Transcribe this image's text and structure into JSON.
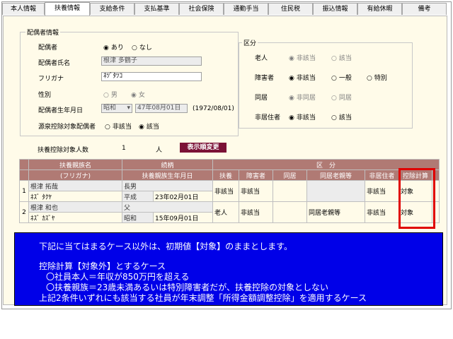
{
  "tabs": [
    "本人情報",
    "扶養情報",
    "支給条件",
    "支払基準",
    "社会保険",
    "通勤手当",
    "住民税",
    "振込情報",
    "有給休暇",
    "備考"
  ],
  "spouse": {
    "group_title": "配偶者情報",
    "has_spouse_label": "配偶者",
    "has_spouse_yes": "あり",
    "has_spouse_no": "なし",
    "name_label": "配偶者氏名",
    "name_value": "根津 多鶴子",
    "kana_label": "フリガナ",
    "kana_value": "ﾈﾂﾞﾀﾂｺ",
    "gender_label": "性別",
    "gender_male": "男",
    "gender_female": "女",
    "birth_label": "配偶者生年月日",
    "era_value": "昭和",
    "birth_value": "47年08月01日",
    "birth_western": "(1972/08/01)",
    "withholding_label": "源泉控除対象配偶者",
    "withholding_no": "非該当",
    "withholding_yes": "該当"
  },
  "classification": {
    "group_title": "区分",
    "elderly_label": "老人",
    "disabled_label": "障害者",
    "cohabit_label": "同居",
    "nonresident_label": "非居住者",
    "opt_na": "非該当",
    "opt_applicable": "該当",
    "opt_general": "一般",
    "opt_special": "特別",
    "opt_not_cohabit": "非同居",
    "opt_cohabit": "同居"
  },
  "dependents_count_label": "扶養控除対象人数",
  "dependents_count": "1",
  "dependents_count_unit": "人",
  "order_change_button": "表示順変更",
  "grid": {
    "header1": {
      "relation": "扶養親族名",
      "rel": "続柄",
      "category": "区　分"
    },
    "header2": {
      "kana": "(フリガナ)",
      "birth": "扶養親族生年月日",
      "dependent": "扶養",
      "disabled": "障害者",
      "cohabit": "同居",
      "elder_cohabit": "同居老親等",
      "nonresident": "非居住者",
      "deduction": "控除計算"
    },
    "rows": [
      {
        "no": "1",
        "name": "根津 拓哉",
        "kana": "ﾈｽﾞ ﾀｸﾔ",
        "relation": "長男",
        "era": "平成",
        "birth": "23年02月01日",
        "dependent": "非該当",
        "disabled": "非該当",
        "cohabit": "",
        "elder": "",
        "nonresident": "非該当",
        "deduction": "対象"
      },
      {
        "no": "2",
        "name": "根津 和也",
        "kana": "ﾈｽﾞ ｶｽﾞﾔ",
        "relation": "父",
        "era": "昭和",
        "birth": "15年09月01日",
        "dependent": "老人",
        "disabled": "非該当",
        "cohabit": "",
        "elder": "同居老親等",
        "nonresident": "非該当",
        "deduction": "対象"
      }
    ]
  },
  "overlay": {
    "line1": "下記に当てはまるケース以外は、初期値【対象】のままとします。",
    "line2": "控除計算【対象外】とするケース",
    "line3": "〇社員本人＝年収が850万円を超える",
    "line4": "〇扶養親族＝23歳未満あるいは特別障害者だが、扶養控除の対象としない",
    "line5": "上記2条件いずれにも該当する社員が年末調整「所得金額調整控除」を適用するケース"
  },
  "colors": {
    "overlay_bg": "#0000e8",
    "header_bg": "#b07a74",
    "button_bg": "#7b1136",
    "highlight": "#e00000",
    "panel_bg": "#fffbe9"
  }
}
